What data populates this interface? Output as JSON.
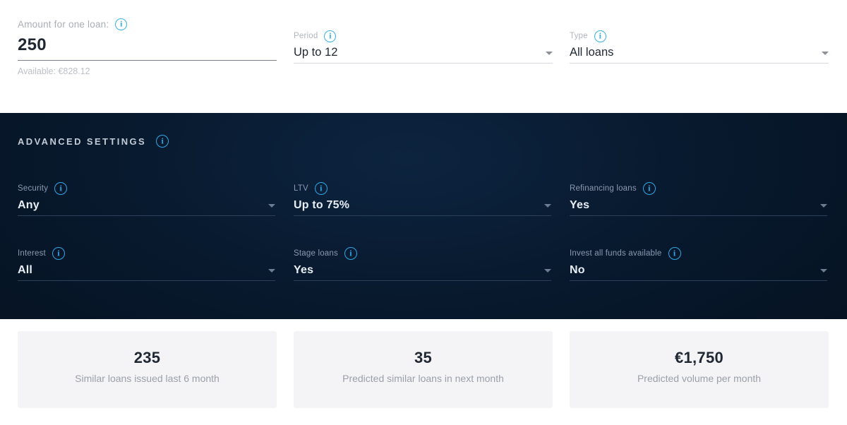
{
  "top_section": {
    "fields": [
      {
        "id": "amount",
        "label": "Amount for one loan:",
        "value": "250",
        "helper": "Available: €828.12",
        "info_icon": "info-icon"
      },
      {
        "id": "period",
        "label": "Period",
        "value": "Up to 12",
        "info_icon": "info-icon",
        "caret_icon": "chevron-down-icon"
      },
      {
        "id": "type",
        "label": "Type",
        "value": "All loans",
        "info_icon": "info-icon",
        "caret_icon": "chevron-down-icon"
      }
    ]
  },
  "advanced": {
    "title": "ADVANCED SETTINGS",
    "info_icon": "info-icon",
    "fields": [
      {
        "id": "security",
        "label": "Security",
        "value": "Any",
        "info_icon": "info-icon",
        "caret_icon": "chevron-down-icon"
      },
      {
        "id": "ltv",
        "label": "LTV",
        "value": "Up to 75%",
        "info_icon": "info-icon",
        "caret_icon": "chevron-down-icon"
      },
      {
        "id": "refinancing",
        "label": "Refinancing loans",
        "value": "Yes",
        "info_icon": "info-icon",
        "caret_icon": "chevron-down-icon"
      },
      {
        "id": "interest",
        "label": "Interest",
        "value": "All",
        "info_icon": "info-icon",
        "caret_icon": "chevron-down-icon"
      },
      {
        "id": "stage",
        "label": "Stage loans",
        "value": "Yes",
        "info_icon": "info-icon",
        "caret_icon": "chevron-down-icon"
      },
      {
        "id": "investall",
        "label": "Invest all funds available",
        "value": "No",
        "info_icon": "info-icon",
        "caret_icon": "chevron-down-icon"
      }
    ]
  },
  "stats": {
    "cards": [
      {
        "id": "similar-issued",
        "value": "235",
        "caption": "Similar loans issued last 6 month"
      },
      {
        "id": "predicted-loans",
        "value": "35",
        "caption": "Predicted similar loans in next month"
      },
      {
        "id": "predicted-volume",
        "value": "€1,750",
        "caption": "Predicted volume per month"
      }
    ]
  },
  "colors": {
    "accent": "#35b1e8",
    "panel_dark": "#061528",
    "card_bg": "#f4f4f7",
    "text_dark": "#1f2733",
    "text_muted": "#a9aeb5"
  }
}
